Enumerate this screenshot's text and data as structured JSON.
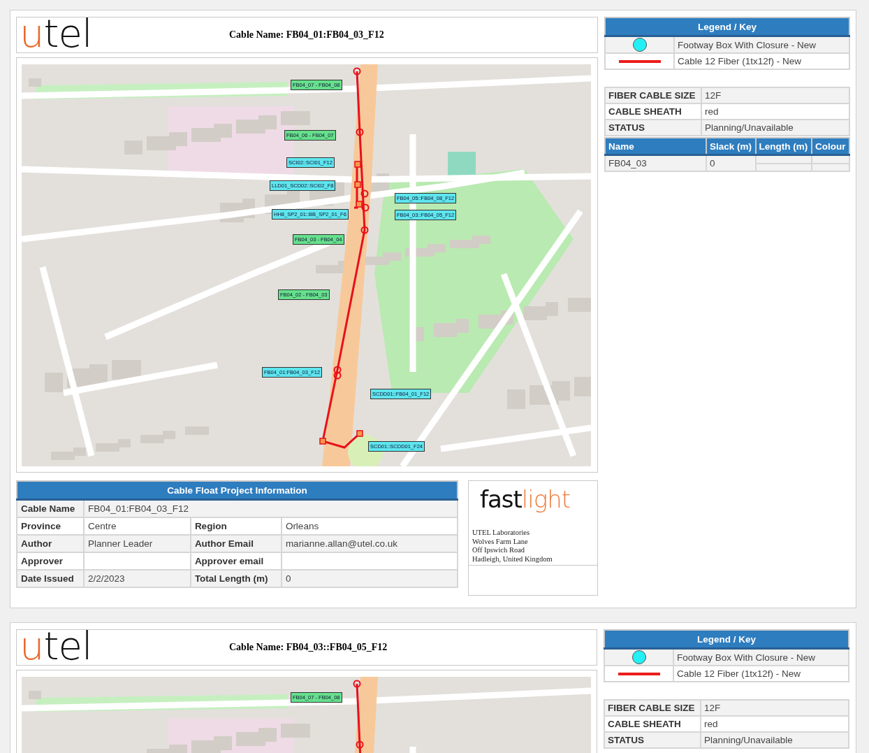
{
  "pages": [
    {
      "header": {
        "logo": {
          "accent": "u",
          "rest": "tel"
        },
        "cable_name": "Cable Name: FB04_01:FB04_03_F12"
      },
      "map": {
        "labels": [
          {
            "text": "FB04_07 - FB04_08",
            "color": "#66e08c"
          },
          {
            "text": "FB04_06 - FB04_07",
            "color": "#66e08c"
          },
          {
            "text": "SCI02::SCI01_F12",
            "color": "#5ee6ee"
          },
          {
            "text": "LLD01_SCD02::SCI02_F8",
            "color": "#5ee6ee"
          },
          {
            "text": "FB04_05::FB04_08_F12",
            "color": "#5ee6ee"
          },
          {
            "text": "HH8_SP2_01::BB_SP2_01_F6",
            "color": "#5ee6ee"
          },
          {
            "text": "FB04_03::FB04_05_F12",
            "color": "#5ee6ee"
          },
          {
            "text": "FB04_03 - FB04_04",
            "color": "#66e08c"
          },
          {
            "text": "FB04_02 - FB04_03",
            "color": "#66e08c"
          },
          {
            "text": "FB04_01:FB04_03_F12",
            "color": "#5ee6ee"
          },
          {
            "text": "SCDD01::FB04_01_F12",
            "color": "#5ee6ee"
          },
          {
            "text": "SCD01::SCDD01_F24",
            "color": "#5ee6ee"
          }
        ]
      },
      "legend": {
        "title": "Legend / Key",
        "items": [
          {
            "kind": "footway-box",
            "label": "Footway Box With Closure - New"
          },
          {
            "kind": "cable",
            "label": "Cable 12 Fiber (1tx12f) - New"
          }
        ]
      },
      "specs": [
        {
          "label": "FIBER CABLE SIZE",
          "value": "12F"
        },
        {
          "label": "CABLE SHEATH",
          "value": "red"
        },
        {
          "label": "STATUS",
          "value": "Planning/Unavailable"
        }
      ],
      "fibers": {
        "columns": [
          "Name",
          "Slack (m)",
          "Length (m)",
          "Colour"
        ],
        "rows": [
          {
            "name": "FB04_03",
            "slack": "0"
          }
        ]
      },
      "project_info": {
        "title": "Cable Float Project Information",
        "cable_name": {
          "label": "Cable Name",
          "value": "FB04_01:FB04_03_F12"
        },
        "rows": [
          [
            {
              "label": "Province",
              "value": "Centre"
            },
            {
              "label": "Region",
              "value": "Orleans"
            }
          ],
          [
            {
              "label": "Author",
              "value": "Planner Leader"
            },
            {
              "label": "Author Email",
              "value": "marianne.allan@utel.co.uk"
            }
          ],
          [
            {
              "label": "Approver"
            },
            {
              "label": "Approver email"
            }
          ],
          [
            {
              "label": "Date Issued",
              "value": "2/2/2023"
            },
            {
              "label": "Total Length (m)",
              "value": "0"
            }
          ]
        ]
      },
      "company": {
        "logo": {
          "dark": "fast",
          "light": "light"
        },
        "address": [
          "UTEL Laboratories",
          "Wolves Farm Lane",
          "Off Ipswich Road",
          "Hadleigh, United Kingdom"
        ]
      }
    },
    {
      "header": {
        "logo": {
          "accent": "u",
          "rest": "tel"
        },
        "cable_name": "Cable Name: FB04_03::FB04_05_F12"
      },
      "map": {
        "labels": [
          {
            "text": "FB04_07 - FB04_08",
            "color": "#66e08c"
          }
        ]
      },
      "legend": {
        "title": "Legend / Key",
        "items": [
          {
            "kind": "footway-box",
            "label": "Footway Box With Closure - New"
          },
          {
            "kind": "cable",
            "label": "Cable 12 Fiber (1tx12f) - New"
          }
        ]
      },
      "specs": [
        {
          "label": "FIBER CABLE SIZE",
          "value": "12F"
        },
        {
          "label": "CABLE SHEATH",
          "value": "red"
        },
        {
          "label": "STATUS",
          "value": "Planning/Unavailable"
        }
      ]
    }
  ]
}
